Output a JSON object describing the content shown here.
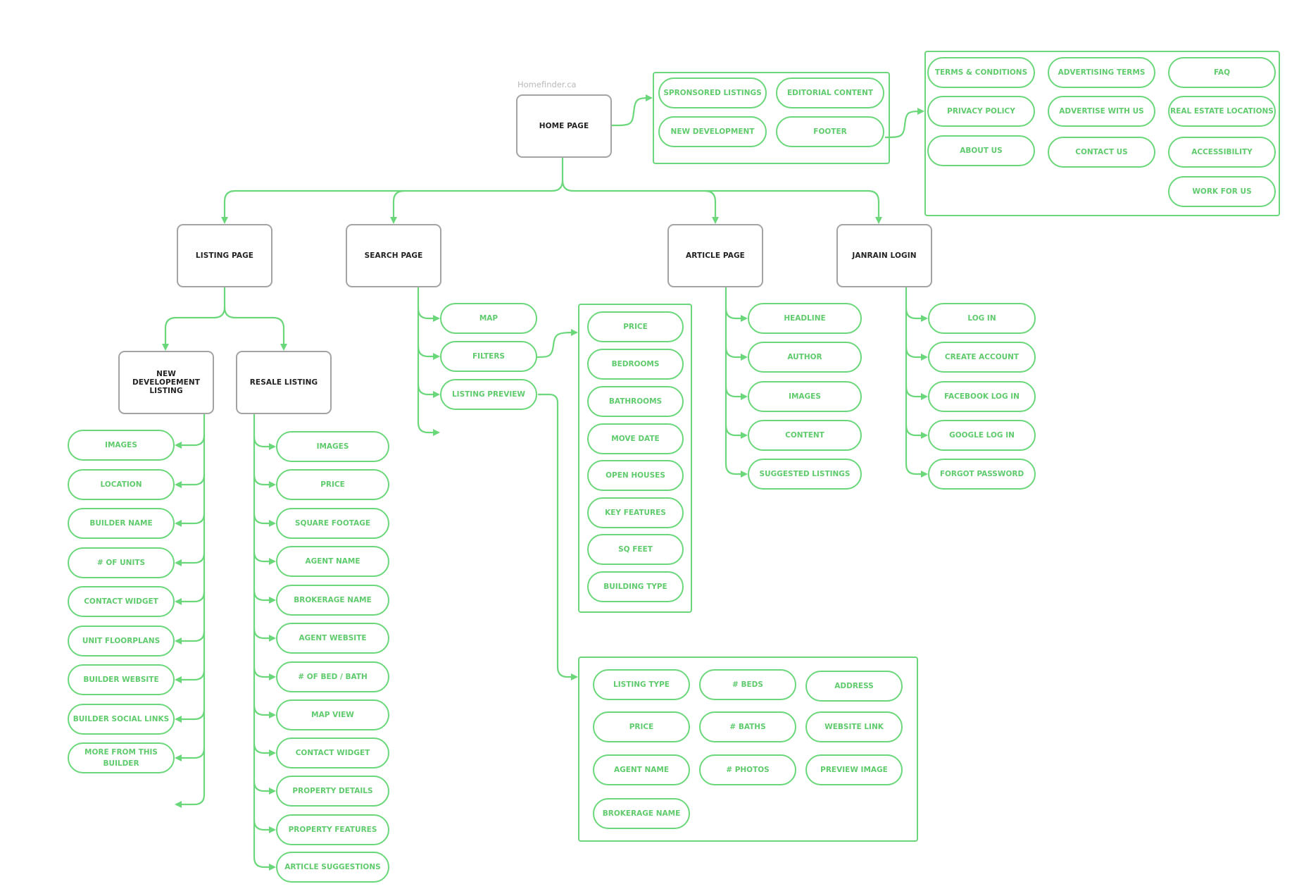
{
  "site_label": "Homefinder.ca",
  "colors": {
    "connector": "#6ad77a",
    "pill_text": "#5fcb6d",
    "node_border": "#a3a3a3",
    "node_text": "#222222"
  },
  "nodes": {
    "home": "HOME PAGE",
    "listing": "LISTING PAGE",
    "search": "SEARCH PAGE",
    "article": "ARTICLE PAGE",
    "janrain": "JANRAIN LOGIN",
    "new_dev": "NEW DEVELOPEMENT LISTING",
    "resale": "RESALE LISTING"
  },
  "home_sections": [
    "SPRONSORED LISTINGS",
    "EDITORIAL CONTENT",
    "NEW DEVELOPMENT",
    "FOOTER"
  ],
  "footer_links": {
    "col1": [
      "TERMS & CONDITIONS",
      "PRIVACY POLICY",
      "ABOUT US"
    ],
    "col2": [
      "ADVERTISING TERMS",
      "ADVERTISE WITH US",
      "CONTACT US"
    ],
    "col3": [
      "FAQ",
      "REAL ESTATE LOCATIONS",
      "ACCESSIBILITY",
      "WORK FOR US"
    ]
  },
  "new_dev_items": [
    "IMAGES",
    "LOCATION",
    "BUILDER NAME",
    "# OF UNITS",
    "CONTACT WIDGET",
    "UNIT FLOORPLANS",
    "BUILDER WEBSITE",
    "BUILDER SOCIAL LINKS",
    "MORE FROM THIS BUILDER"
  ],
  "resale_items": [
    "IMAGES",
    "PRICE",
    "SQUARE FOOTAGE",
    "AGENT NAME",
    "BROKERAGE NAME",
    "AGENT WEBSITE",
    "# OF BED / BATH",
    "MAP VIEW",
    "CONTACT WIDGET",
    "PROPERTY DETAILS",
    "PROPERTY FEATURES",
    "ARTICLE SUGGESTIONS"
  ],
  "search_items": [
    "MAP",
    "FILTERS",
    "LISTING PREVIEW"
  ],
  "filter_items": [
    "PRICE",
    "BEDROOMS",
    "BATHROOMS",
    "MOVE DATE",
    "OPEN HOUSES",
    "KEY FEATURES",
    "SQ FEET",
    "BUILDING TYPE"
  ],
  "preview_items": {
    "col1": [
      "LISTING TYPE",
      "PRICE",
      "AGENT NAME",
      "BROKERAGE NAME"
    ],
    "col2": [
      "# BEDS",
      "# BATHS",
      "# PHOTOS"
    ],
    "col3": [
      "ADDRESS",
      "WEBSITE LINK",
      "PREVIEW IMAGE"
    ]
  },
  "article_items": [
    "HEADLINE",
    "AUTHOR",
    "IMAGES",
    "CONTENT",
    "SUGGESTED LISTINGS"
  ],
  "login_items": [
    "LOG IN",
    "CREATE ACCOUNT",
    "FACEBOOK LOG IN",
    "GOOGLE LOG IN",
    "FORGOT PASSWORD"
  ]
}
